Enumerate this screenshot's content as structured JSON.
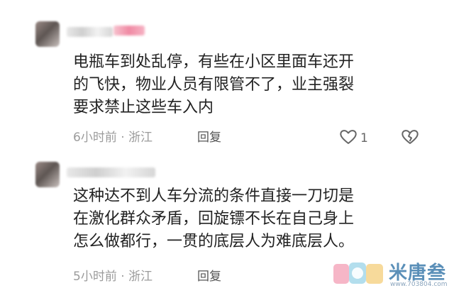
{
  "comments": [
    {
      "text": "电瓶车到处乱停，有些在小区里面车还开\n的飞快，物业人员有限管不了，业主强裂\n要求禁止这些车入内",
      "time": "6小时前",
      "location": "浙江",
      "reply_label": "回复",
      "like_count": "1"
    },
    {
      "text": "这种达不到人车分流的条件直接一刀切是\n在激化群众矛盾，回旋镖不长在自己身上\n怎么做都行，一贯的底层人为难底层人。",
      "time": "5小时前",
      "location": "浙江",
      "reply_label": "回复",
      "like_count": ""
    }
  ],
  "meta_separator": " · ",
  "watermark": {
    "brand": "米唐叁",
    "url": "www.703804.com"
  },
  "icons": {
    "like": "heart-outline-icon",
    "dislike": "broken-heart-icon"
  },
  "colors": {
    "text": "#222222",
    "meta": "#9b9b9b",
    "accent_pink": "#f08aa4",
    "watermark_blue": "#5a8fb8"
  }
}
